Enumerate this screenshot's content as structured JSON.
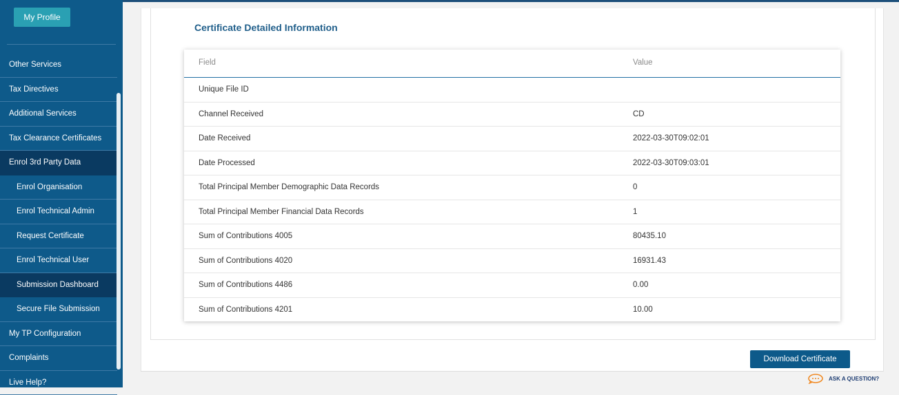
{
  "sidebar": {
    "profile_button": "My Profile",
    "items": [
      {
        "label": "Other Services"
      },
      {
        "label": "Tax Directives"
      },
      {
        "label": "Additional Services"
      },
      {
        "label": "Tax Clearance Certificates"
      },
      {
        "label": "Enrol 3rd Party Data"
      },
      {
        "label": "Enrol Organisation"
      },
      {
        "label": "Enrol Technical Admin"
      },
      {
        "label": "Request Certificate"
      },
      {
        "label": "Enrol Technical User"
      },
      {
        "label": "Submission Dashboard"
      },
      {
        "label": "Secure File Submission"
      },
      {
        "label": "My TP Configuration"
      },
      {
        "label": "Complaints"
      },
      {
        "label": "Live Help?"
      }
    ]
  },
  "main": {
    "title": "Certificate Detailed Information",
    "table": {
      "headers": [
        "Field",
        "Value"
      ],
      "rows": [
        {
          "field": "Unique File ID",
          "value": ""
        },
        {
          "field": "Channel Received",
          "value": "CD"
        },
        {
          "field": "Date Received",
          "value": "2022-03-30T09:02:01"
        },
        {
          "field": "Date Processed",
          "value": "2022-03-30T09:03:01"
        },
        {
          "field": "Total Principal Member Demographic Data Records",
          "value": "0"
        },
        {
          "field": "Total Principal Member Financial Data Records",
          "value": "1"
        },
        {
          "field": "Sum of Contributions 4005",
          "value": "80435.10"
        },
        {
          "field": "Sum of Contributions 4020",
          "value": "16931.43"
        },
        {
          "field": "Sum of Contributions 4486",
          "value": "0.00"
        },
        {
          "field": "Sum of Contributions 4201",
          "value": "10.00"
        }
      ]
    },
    "download_button": "Download Certificate",
    "ask_question": "ASK A QUESTION?"
  },
  "colors": {
    "sidebar": "#0e5a8a",
    "sidebar_active": "#0a3a61",
    "accent": "#2aa0b3",
    "button": "#0d5a8a"
  }
}
